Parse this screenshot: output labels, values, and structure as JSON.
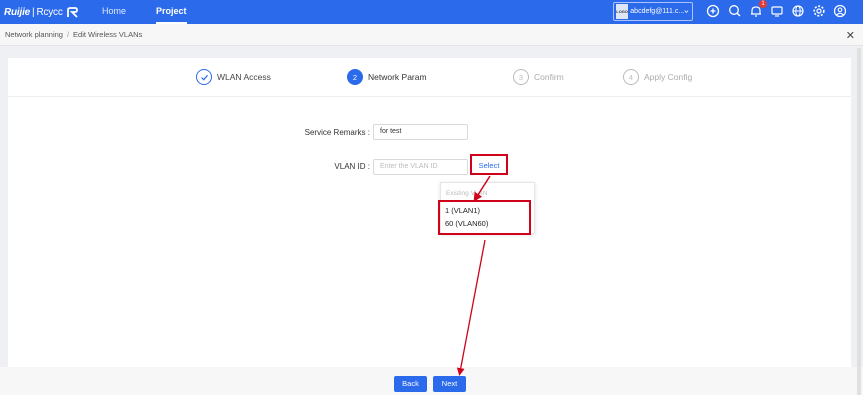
{
  "topbar": {
    "logo_brand": "Ruijie",
    "logo_separator": "|",
    "logo_product": "Rcycc",
    "nav": [
      {
        "label": "Home"
      },
      {
        "label": "Project"
      }
    ],
    "account_badge": "LOGO",
    "account_email": "abcdefg@111.c...",
    "notification_count": "1",
    "icons": [
      "plus-circle-icon",
      "search-icon",
      "bell-icon",
      "message-icon",
      "globe-icon",
      "gear-icon",
      "user-icon"
    ]
  },
  "breadcrumb": {
    "root": "Network planning",
    "separator": "/",
    "current": "Edit Wireless VLANs"
  },
  "steps": [
    {
      "number": "",
      "label": "WLAN Access",
      "state": "done"
    },
    {
      "number": "2",
      "label": "Network Param",
      "state": "active"
    },
    {
      "number": "3",
      "label": "Confirm",
      "state": "todo"
    },
    {
      "number": "4",
      "label": "Apply Config",
      "state": "todo"
    }
  ],
  "form": {
    "remarks_label": "Service Remarks :",
    "remarks_value": "for test",
    "vlan_label": "VLAN ID :",
    "vlan_placeholder": "Enter the VLAN ID",
    "select_label": "Select"
  },
  "dropdown": {
    "header": "Existing VLAN",
    "options": [
      "1 (VLAN1)",
      "60 (VLAN60)"
    ]
  },
  "footer": {
    "back_label": "Back",
    "next_label": "Next"
  },
  "colors": {
    "primary": "#2b6aea",
    "annotation": "#d0021b"
  }
}
